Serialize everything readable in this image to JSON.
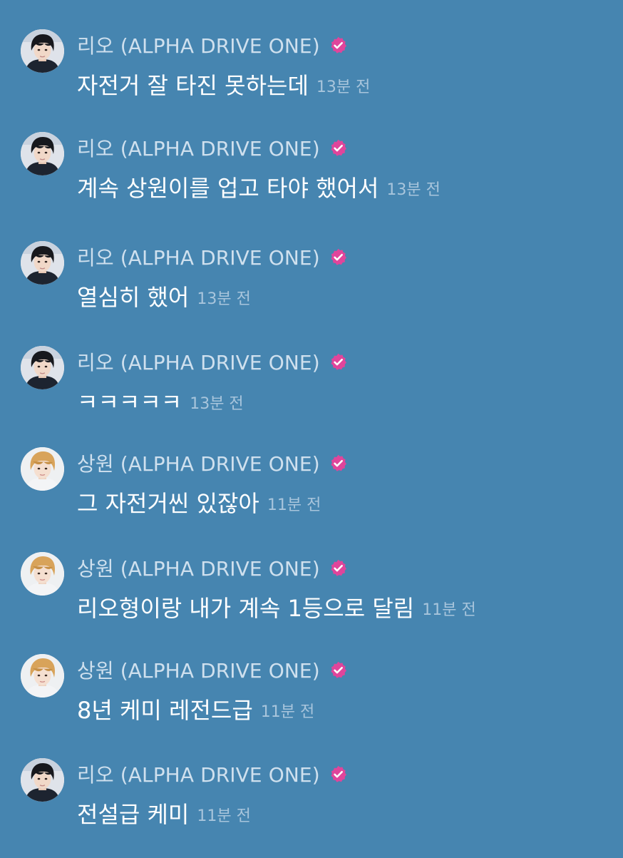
{
  "colors": {
    "background": "#4685b0",
    "author_name": "#cfe0ee",
    "message_text": "#ffffff",
    "timestamp": "#a8c5dc",
    "verified_badge": "#e0459b"
  },
  "icons": {
    "verified": "verified-badge-icon"
  },
  "messages": [
    {
      "author": "리오 (ALPHA DRIVE ONE)",
      "avatar": "rio-avatar",
      "text": "자전거 잘 타진 못하는데",
      "time": "13분 전"
    },
    {
      "author": "리오 (ALPHA DRIVE ONE)",
      "avatar": "rio-avatar",
      "text": "계속 상원이를 업고 타야 했어서",
      "time": "13분 전"
    },
    {
      "author": "리오 (ALPHA DRIVE ONE)",
      "avatar": "rio-avatar",
      "text": "열심히 했어",
      "time": "13분 전"
    },
    {
      "author": "리오 (ALPHA DRIVE ONE)",
      "avatar": "rio-avatar",
      "text": "ㅋㅋㅋㅋㅋ",
      "time": "13분 전"
    },
    {
      "author": "상원 (ALPHA DRIVE ONE)",
      "avatar": "sangwon-avatar",
      "text": "그 자전거씬 있잖아",
      "time": "11분 전"
    },
    {
      "author": "상원 (ALPHA DRIVE ONE)",
      "avatar": "sangwon-avatar",
      "text": "리오형이랑 내가 계속 1등으로 달림",
      "time": "11분 전"
    },
    {
      "author": "상원 (ALPHA DRIVE ONE)",
      "avatar": "sangwon-avatar",
      "text": "8년 케미 레전드급",
      "time": "11분 전"
    },
    {
      "author": "리오 (ALPHA DRIVE ONE)",
      "avatar": "rio-avatar",
      "text": "전설급 케미",
      "time": "11분 전"
    }
  ]
}
